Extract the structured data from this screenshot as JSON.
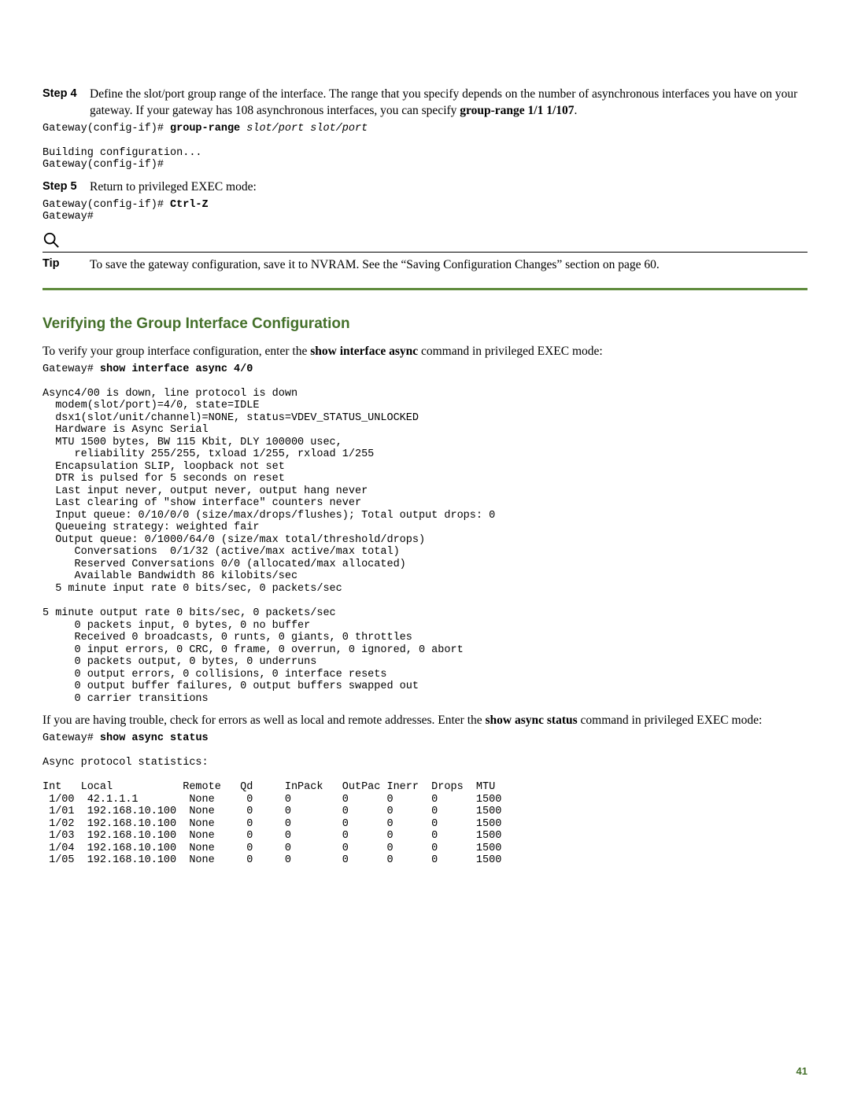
{
  "step4": {
    "label": "Step 4",
    "text_parts": {
      "a": "Define the slot/port group range of the interface. The range that you specify depends on the number of asynchronous interfaces you have on your gateway. If your gateway has 108 asynchronous interfaces, you can specify ",
      "b": "group-range 1/1 1/107",
      "c": "."
    }
  },
  "code1": {
    "prefix": "Gateway(config-if)# ",
    "cmd": "group-range",
    "args": " slot/port slot/port",
    "cont": "\n\nBuilding configuration...\nGateway(config-if)#"
  },
  "step5": {
    "label": "Step 5",
    "text": "Return to privileged EXEC mode:"
  },
  "code2": {
    "prefix": "Gateway(config-if)# ",
    "cmd": "Ctrl-Z",
    "cont": "\nGateway#"
  },
  "tip": {
    "label": "Tip",
    "text": "To save the gateway configuration, save it to NVRAM. See the “Saving Configuration Changes” section on page 60."
  },
  "section": {
    "title": "Verifying the Group Interface Configuration",
    "intro_a": "To verify your group interface configuration, enter the ",
    "intro_b": "show interface async",
    "intro_c": " command in privileged EXEC mode:"
  },
  "code3": {
    "prefix": "Gateway# ",
    "cmd": "show interface async 4/0",
    "output": "\n\nAsync4/00 is down, line protocol is down\n  modem(slot/port)=4/0, state=IDLE\n  dsx1(slot/unit/channel)=NONE, status=VDEV_STATUS_UNLOCKED\n  Hardware is Async Serial\n  MTU 1500 bytes, BW 115 Kbit, DLY 100000 usec,\n     reliability 255/255, txload 1/255, rxload 1/255\n  Encapsulation SLIP, loopback not set\n  DTR is pulsed for 5 seconds on reset\n  Last input never, output never, output hang never\n  Last clearing of \"show interface\" counters never\n  Input queue: 0/10/0/0 (size/max/drops/flushes); Total output drops: 0\n  Queueing strategy: weighted fair\n  Output queue: 0/1000/64/0 (size/max total/threshold/drops)\n     Conversations  0/1/32 (active/max active/max total)\n     Reserved Conversations 0/0 (allocated/max allocated)\n     Available Bandwidth 86 kilobits/sec\n  5 minute input rate 0 bits/sec, 0 packets/sec\n\n5 minute output rate 0 bits/sec, 0 packets/sec\n     0 packets input, 0 bytes, 0 no buffer\n     Received 0 broadcasts, 0 runts, 0 giants, 0 throttles\n     0 input errors, 0 CRC, 0 frame, 0 overrun, 0 ignored, 0 abort\n     0 packets output, 0 bytes, 0 underruns\n     0 output errors, 0 collisions, 0 interface resets\n     0 output buffer failures, 0 output buffers swapped out\n     0 carrier transitions"
  },
  "para2": {
    "a": "If you are having trouble, check for errors as well as local and remote addresses. Enter the ",
    "b": "show async status",
    "c": " command in privileged EXEC mode:"
  },
  "code4": {
    "prefix": "Gateway# ",
    "cmd": "show async status",
    "output_head": "\n\nAsync protocol statistics:\n\n",
    "header": "Int   Local           Remote   Qd     InPack   OutPac Inerr  Drops  MTU",
    "rows": [
      " 1/00  42.1.1.1        None     0     0        0      0      0      1500",
      " 1/01  192.168.10.100  None     0     0        0      0      0      1500",
      " 1/02  192.168.10.100  None     0     0        0      0      0      1500",
      " 1/03  192.168.10.100  None     0     0        0      0      0      1500",
      " 1/04  192.168.10.100  None     0     0        0      0      0      1500",
      " 1/05  192.168.10.100  None     0     0        0      0      0      1500"
    ]
  },
  "page_number": "41"
}
